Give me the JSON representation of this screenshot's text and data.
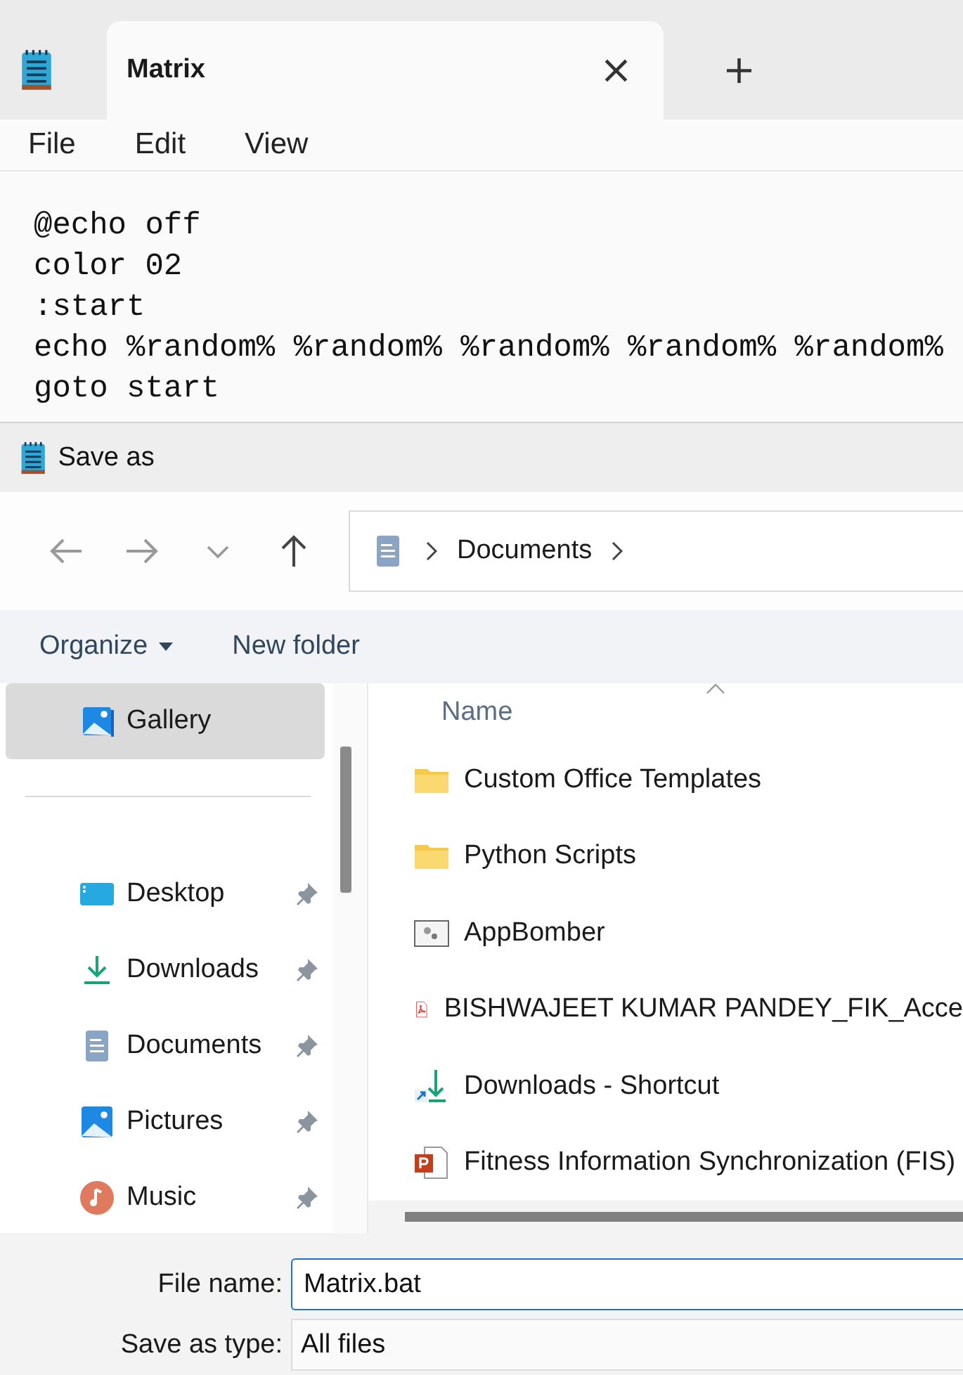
{
  "notepad": {
    "tab": {
      "title": "Matrix",
      "close": "×",
      "new_tab": "+"
    },
    "menu": [
      "File",
      "Edit",
      "View"
    ],
    "lines": [
      "@echo off",
      "color 02",
      ":start",
      "echo %random% %random% %random% %random% %random%",
      "goto start"
    ]
  },
  "dialog": {
    "title": "Save as",
    "breadcrumb": [
      "Documents"
    ],
    "commands": {
      "organize": "Organize",
      "new_folder": "New folder"
    },
    "sidebar": [
      {
        "kind": "gallery",
        "label": "Gallery",
        "selected": true,
        "pinned": false
      },
      {
        "kind": "desktop",
        "label": "Desktop",
        "selected": false,
        "pinned": true
      },
      {
        "kind": "downloads",
        "label": "Downloads",
        "selected": false,
        "pinned": true
      },
      {
        "kind": "documents",
        "label": "Documents",
        "selected": false,
        "pinned": true
      },
      {
        "kind": "pictures",
        "label": "Pictures",
        "selected": false,
        "pinned": true
      },
      {
        "kind": "music",
        "label": "Music",
        "selected": false,
        "pinned": true
      }
    ],
    "column": "Name",
    "files": [
      {
        "kind": "folder",
        "name": "Custom Office Templates"
      },
      {
        "kind": "folder",
        "name": "Python Scripts"
      },
      {
        "kind": "app",
        "name": "AppBomber"
      },
      {
        "kind": "pdf",
        "name": "BISHWAJEET KUMAR PANDEY_FIK_Acce"
      },
      {
        "kind": "shortcut",
        "name": "Downloads - Shortcut"
      },
      {
        "kind": "pptx",
        "name": "Fitness Information Synchronization (FIS)"
      }
    ],
    "file_name": {
      "label": "File name:",
      "value": "Matrix.bat"
    },
    "save_type": {
      "label": "Save as type:",
      "value": "All files"
    }
  }
}
